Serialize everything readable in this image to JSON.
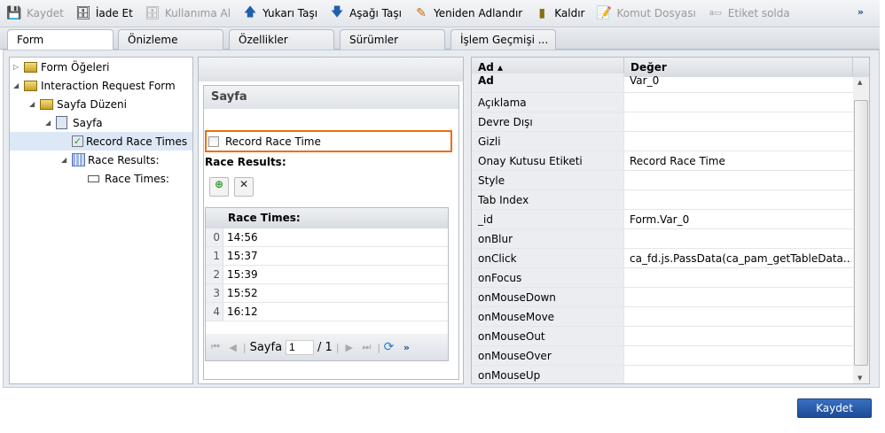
{
  "toolbar": {
    "items": [
      {
        "label": "Kaydet",
        "icon": "save-icon",
        "disabled": true
      },
      {
        "label": "İade Et",
        "icon": "check-in-icon",
        "disabled": false
      },
      {
        "label": "Kullanıma Al",
        "icon": "check-out-icon",
        "disabled": true
      },
      {
        "label": "Yukarı Taşı",
        "icon": "arrow-up-icon",
        "disabled": false
      },
      {
        "label": "Aşağı Taşı",
        "icon": "arrow-down-icon",
        "disabled": false
      },
      {
        "label": "Yeniden Adlandır",
        "icon": "pencil-icon",
        "disabled": false
      },
      {
        "label": "Kaldır",
        "icon": "trash-icon",
        "disabled": false
      },
      {
        "label": "Komut Dosyası",
        "icon": "script-icon",
        "disabled": true
      },
      {
        "label": "Etiket solda",
        "icon": "label-left-icon",
        "disabled": true
      }
    ],
    "more": "»"
  },
  "tabs": [
    "Form",
    "Önizleme",
    "Özellikler",
    "Sürümler",
    "İşlem Geçmişi ..."
  ],
  "tree": [
    "Form Öğeleri",
    "Interaction Request Form",
    "Sayfa Düzeni",
    "Sayfa",
    "Record Race Times",
    "Race Results:",
    "Race Times:"
  ],
  "preview": {
    "panel_title": "Sayfa",
    "checkbox_label": "Record Race Time",
    "table_label": "Race Results:",
    "column": "Race Times:",
    "rows": [
      "14:56",
      "15:37",
      "15:39",
      "15:52",
      "16:12"
    ],
    "pager": {
      "page_label": "Sayfa",
      "page": "1",
      "of": "/ 1"
    }
  },
  "props": {
    "headers": [
      "Ad ▴",
      "Değer"
    ],
    "rows": [
      [
        "Ad",
        "Var_0"
      ],
      [
        "Açıklama",
        ""
      ],
      [
        "Devre Dışı",
        ""
      ],
      [
        "Gizli",
        ""
      ],
      [
        "Onay Kutusu Etiketi",
        "Record Race Time"
      ],
      [
        "Style",
        ""
      ],
      [
        "Tab Index",
        ""
      ],
      [
        "_id",
        "Form.Var_0"
      ],
      [
        "onBlur",
        ""
      ],
      [
        "onClick",
        "ca_fd.js.PassData(ca_pam_getTableData..."
      ],
      [
        "onFocus",
        ""
      ],
      [
        "onMouseDown",
        ""
      ],
      [
        "onMouseMove",
        ""
      ],
      [
        "onMouseOut",
        ""
      ],
      [
        "onMouseOver",
        ""
      ],
      [
        "onMouseUp",
        ""
      ]
    ]
  },
  "footer": {
    "save": "Kaydet"
  }
}
